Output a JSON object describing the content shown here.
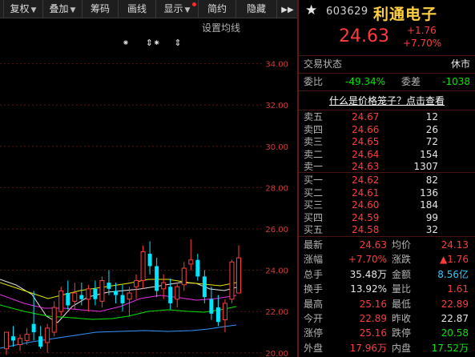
{
  "toolbar": {
    "items": [
      "复权",
      "叠加",
      "筹码",
      "画线",
      "显示",
      "简约",
      "隐藏"
    ],
    "expand": "▶▶"
  },
  "chart": {
    "settings_label": "设置均线",
    "markers": [
      "⁕",
      "⇕⁕",
      "⇕"
    ],
    "y_ticks": [
      "34.00",
      "32.00",
      "30.00",
      "28.00",
      "26.00",
      "24.00",
      "22.00",
      "20.00"
    ]
  },
  "chart_data": {
    "type": "candlestick",
    "ylim": [
      19.8,
      36
    ],
    "up_color": "#ff3c3c",
    "down_color": "#00e6ff",
    "candles": [
      [
        20.2,
        21.0,
        19.9,
        21.0
      ],
      [
        20.8,
        21.3,
        20.3,
        20.6
      ],
      [
        20.4,
        20.9,
        20.1,
        20.7
      ],
      [
        20.6,
        21.2,
        20.4,
        20.9
      ],
      [
        21.4,
        23.0,
        20.6,
        21.0
      ],
      [
        20.8,
        21.3,
        20.2,
        20.3
      ],
      [
        20.5,
        21.4,
        20.0,
        21.2
      ],
      [
        21.0,
        22.5,
        20.8,
        22.2
      ],
      [
        22.0,
        23.2,
        21.8,
        23.0
      ],
      [
        22.9,
        23.5,
        22.1,
        22.3
      ],
      [
        22.5,
        23.4,
        22.1,
        22.9
      ],
      [
        22.8,
        23.4,
        22.3,
        22.6
      ],
      [
        22.6,
        23.3,
        22.0,
        23.1
      ],
      [
        23.1,
        23.5,
        22.3,
        22.6
      ],
      [
        22.5,
        23.7,
        22.2,
        23.5
      ],
      [
        23.4,
        24.0,
        22.8,
        23.1
      ],
      [
        23.0,
        23.4,
        22.4,
        22.8
      ],
      [
        22.8,
        23.3,
        22.0,
        22.4
      ],
      [
        22.6,
        23.2,
        21.8,
        22.9
      ],
      [
        23.2,
        23.8,
        22.6,
        23.5
      ],
      [
        23.5,
        25.2,
        23.1,
        24.9
      ],
      [
        24.8,
        25.4,
        23.8,
        24.2
      ],
      [
        24.2,
        24.6,
        22.7,
        23.0
      ],
      [
        23.1,
        23.8,
        22.6,
        23.4
      ],
      [
        23.2,
        23.6,
        22.1,
        22.4
      ],
      [
        22.6,
        23.4,
        22.2,
        23.2
      ],
      [
        23.3,
        24.4,
        23.0,
        24.1
      ],
      [
        24.3,
        25.5,
        24.0,
        24.5
      ],
      [
        24.5,
        24.8,
        23.5,
        23.7
      ],
      [
        23.7,
        24.0,
        22.4,
        22.7
      ],
      [
        22.6,
        23.2,
        21.6,
        21.9
      ],
      [
        22.2,
        22.8,
        21.3,
        21.5
      ],
      [
        21.6,
        22.6,
        21.0,
        22.4
      ],
      [
        22.6,
        24.5,
        22.4,
        24.4
      ],
      [
        22.9,
        25.2,
        22.9,
        24.6
      ]
    ]
  },
  "stock": {
    "star": "★",
    "code": "603629",
    "name": "利通电子",
    "price": "24.63",
    "change": "+1.76",
    "change_pct": "+7.70%"
  },
  "status": {
    "label": "交易状态",
    "value": "休市"
  },
  "weibi": {
    "label": "委比",
    "value": "-49.34%",
    "cha_label": "委差",
    "cha_value": "-1038"
  },
  "link": "什么是价格笼子？点击查看",
  "sells": [
    {
      "label": "卖五",
      "price": "24.67",
      "vol": "12"
    },
    {
      "label": "卖四",
      "price": "24.66",
      "vol": "26"
    },
    {
      "label": "卖三",
      "price": "24.65",
      "vol": "72"
    },
    {
      "label": "卖二",
      "price": "24.64",
      "vol": "154"
    },
    {
      "label": "卖一",
      "price": "24.63",
      "vol": "1307"
    }
  ],
  "buys": [
    {
      "label": "买一",
      "price": "24.62",
      "vol": "82"
    },
    {
      "label": "买二",
      "price": "24.61",
      "vol": "136"
    },
    {
      "label": "买三",
      "price": "24.60",
      "vol": "184"
    },
    {
      "label": "买四",
      "price": "24.59",
      "vol": "99"
    },
    {
      "label": "买五",
      "price": "24.58",
      "vol": "32"
    }
  ],
  "quotes": [
    {
      "l1": "最新",
      "v1": "24.63",
      "c1": "red",
      "l2": "均价",
      "v2": "24.13",
      "c2": "red"
    },
    {
      "l1": "涨幅",
      "v1": "+7.70%",
      "c1": "red",
      "l2": "涨跌",
      "v2": "▲1.76",
      "c2": "red"
    },
    {
      "l1": "总手",
      "v1": "35.48万",
      "c1": "white",
      "l2": "金额",
      "v2": "8.56亿",
      "c2": "cyan"
    },
    {
      "l1": "换手",
      "v1": "13.92%",
      "c1": "white",
      "l2": "量比",
      "v2": "1.61",
      "c2": "red"
    },
    {
      "l1": "最高",
      "v1": "25.16",
      "c1": "red",
      "l2": "最低",
      "v2": "22.89",
      "c2": "red"
    },
    {
      "l1": "今开",
      "v1": "22.89",
      "c1": "red",
      "l2": "昨收",
      "v2": "22.87",
      "c2": "white"
    },
    {
      "l1": "涨停",
      "v1": "25.16",
      "c1": "red",
      "l2": "跌停",
      "v2": "20.58",
      "c2": "green"
    },
    {
      "l1": "外盘",
      "v1": "17.96万",
      "c1": "red",
      "l2": "内盘",
      "v2": "17.52万",
      "c2": "green"
    }
  ]
}
